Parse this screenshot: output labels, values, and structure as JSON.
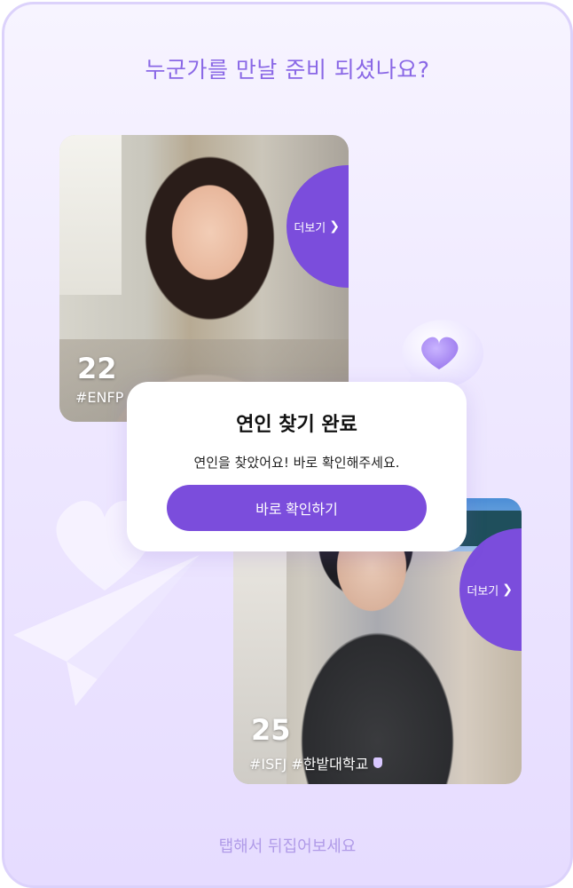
{
  "header": {
    "title": "누군가를 만날 준비 되셨나요?"
  },
  "profiles": [
    {
      "age": "22",
      "tags": "#ENFP",
      "more_label": "더보기",
      "chevron": "❯"
    },
    {
      "age": "25",
      "tags": "#ISFJ #한밭대학교",
      "more_label": "더보기",
      "chevron": "❯"
    }
  ],
  "modal": {
    "title": "연인 찾기 완료",
    "message": "연인을 찾았어요! 바로 확인해주세요.",
    "button_label": "바로 확인하기"
  },
  "footer": {
    "hint": "탭해서 뒤집어보세요"
  },
  "colors": {
    "accent": "#7b4ddc",
    "headline": "#8a68e6",
    "background": "#efe9ff"
  }
}
